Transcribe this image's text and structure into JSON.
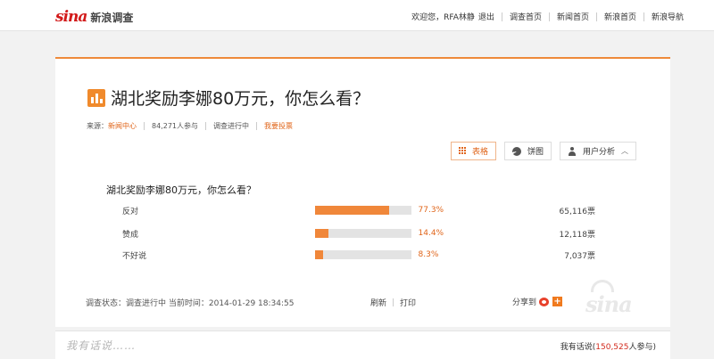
{
  "header": {
    "logo_word": "sina",
    "logo_label": "新浪调查",
    "greeting": "欢迎您，RFA林静",
    "nav": [
      "退出",
      "调查首页",
      "新闻首页",
      "新浪首页",
      "新浪导航"
    ]
  },
  "survey": {
    "title": "湖北奖励李娜80万元，你怎么看？",
    "source_label": "来源：",
    "source_link": "新闻中心",
    "participants": "84,271人参与",
    "status": "调查进行中",
    "vote_link": "我要投票",
    "view_buttons": {
      "table": "表格",
      "pie": "饼图",
      "user_analysis": "用户分析"
    },
    "question": "湖北奖励李娜80万元，你怎么看？",
    "options": [
      {
        "label": "反对",
        "percent_text": "77.3%",
        "fraction": 0.773,
        "votes": "65,116票"
      },
      {
        "label": "赞成",
        "percent_text": "14.4%",
        "fraction": 0.144,
        "votes": "12,118票"
      },
      {
        "label": "不好说",
        "percent_text": "8.3%",
        "fraction": 0.083,
        "votes": "7,037票"
      }
    ],
    "footer_status": "调查状态：调查进行中   当前时间：2014-01-29 18:34:55",
    "refresh": "刷新",
    "print": "打印",
    "share_label": "分享到",
    "watermark": "sina"
  },
  "comments": {
    "hint": "我有话说……",
    "count_prefix": "我有话说(",
    "count": "150,525",
    "count_suffix": "人参与)"
  },
  "colors": {
    "accent": "#f0873a",
    "brand_red": "#d21a1a"
  }
}
